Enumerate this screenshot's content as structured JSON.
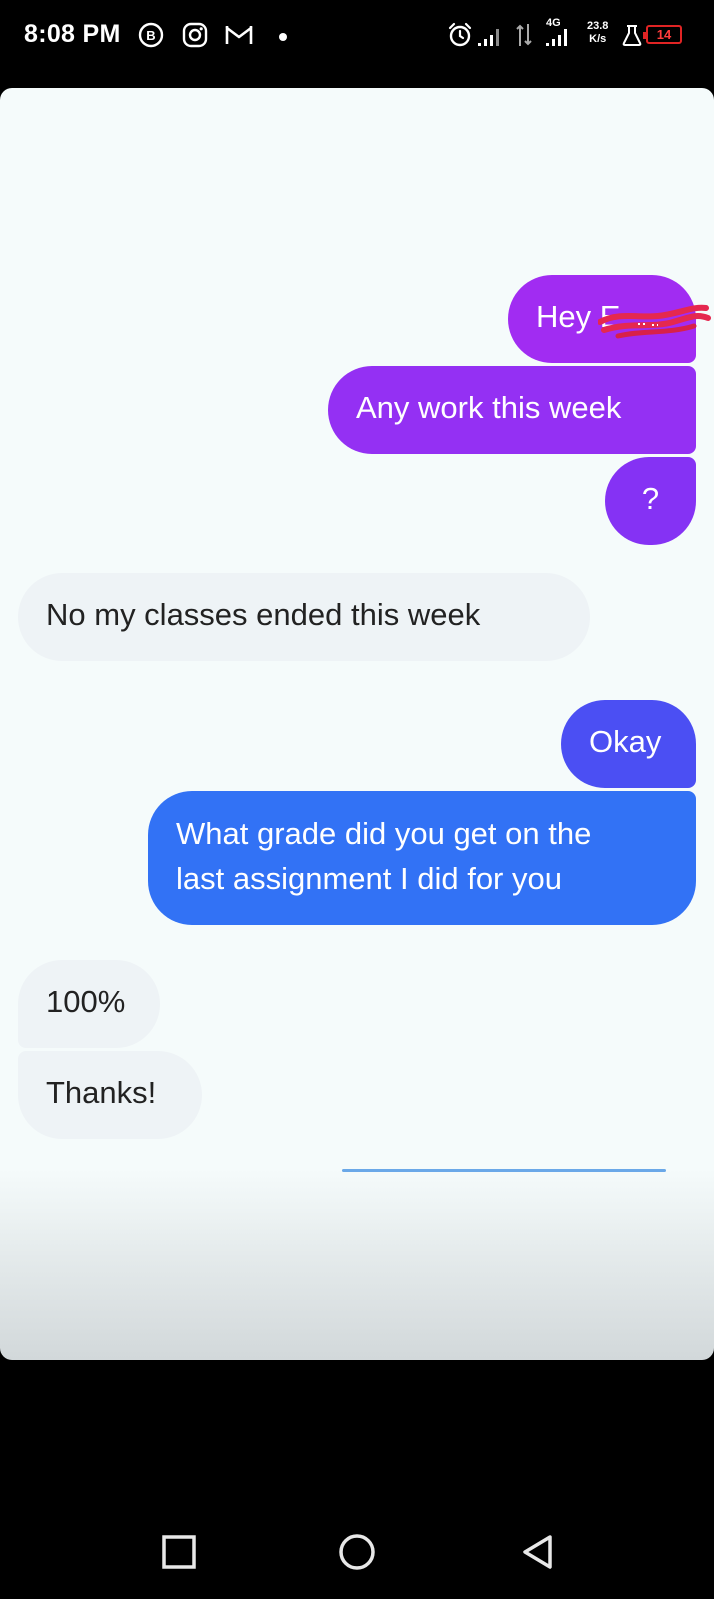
{
  "status_bar": {
    "time": "8:08 PM",
    "notification_icons": [
      "b-badge-icon",
      "instagram-icon",
      "gmail-icon",
      "dot-icon"
    ],
    "network_type": "4G",
    "speed_value": "23.8",
    "speed_unit": "K/s",
    "battery": "14",
    "colors": {
      "battery_low": "#e02424"
    }
  },
  "conversation": {
    "messages": [
      {
        "sender": "me",
        "text": "Hey E",
        "redacted": true
      },
      {
        "sender": "me",
        "text": "Any work this week"
      },
      {
        "sender": "me",
        "text": "?"
      },
      {
        "sender": "them",
        "text": "No my classes ended this week"
      },
      {
        "sender": "me",
        "text": "Okay"
      },
      {
        "sender": "me",
        "text": "What grade did you get on the"
      },
      {
        "sender": "me",
        "text": "last assignment I did for you"
      },
      {
        "sender": "them",
        "text": "100%"
      },
      {
        "sender": "them",
        "text": "Thanks!"
      }
    ],
    "colors": {
      "sent_top": "#a02cf0",
      "sent_mid": "#7a36f6",
      "sent_bottom": "#2f6ff5",
      "received_bg": "#eef3f6"
    }
  },
  "nav_bar": {
    "buttons": [
      "recents-icon",
      "home-icon",
      "back-icon"
    ]
  }
}
